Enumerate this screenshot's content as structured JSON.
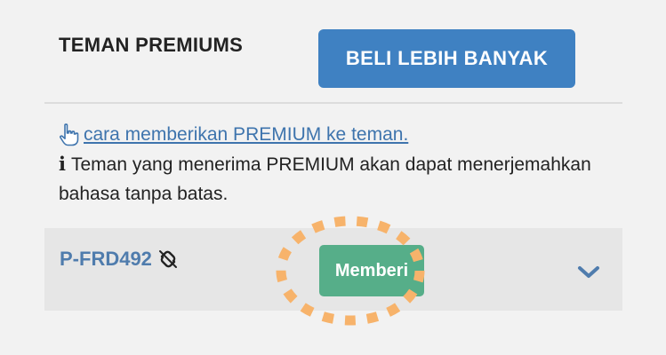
{
  "header": {
    "title": "TEMAN PREMIUMS",
    "buy_button_label": "BELI LEBIH BANYAK"
  },
  "info": {
    "link_text": "cara memberikan PREMIUM ke teman.",
    "info_icon_glyph": "i",
    "description": "Teman yang menerima PREMIUM akan dapat menerjemahkan bahasa tanpa batas."
  },
  "friend": {
    "id": "P-FRD492",
    "give_button_label": "Memberi"
  },
  "icons": {
    "hand": "pointing-hand-icon",
    "info": "info-icon",
    "unlink": "broken-link-icon",
    "expand": "chevron-down-icon"
  },
  "colors": {
    "accent_blue": "#3f81c2",
    "link_blue": "#3e74ad",
    "friend_id_blue": "#4f7cad",
    "give_green": "#56ae89",
    "highlight_orange": "#f7b36b",
    "row_gray": "#e6e6e6",
    "background": "#f2f2f2"
  }
}
